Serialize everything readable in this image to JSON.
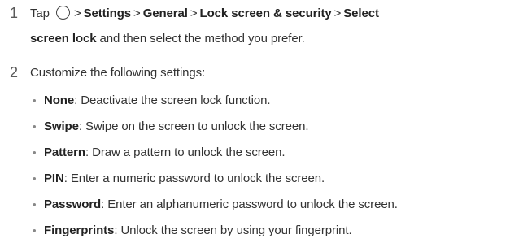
{
  "steps": [
    {
      "number": "1",
      "tap": "Tap",
      "icon": "home-circle-icon",
      "path": [
        "Settings",
        "General",
        "Lock screen & security",
        "Select"
      ],
      "path_separator": ">",
      "bold_continuation": "screen lock",
      "tail": " and then select the method you prefer."
    },
    {
      "number": "2",
      "text": "Customize the following settings:"
    }
  ],
  "settings": [
    {
      "name": "None",
      "desc": ": Deactivate the screen lock function."
    },
    {
      "name": "Swipe",
      "desc": ": Swipe on the screen to unlock the screen."
    },
    {
      "name": "Pattern",
      "desc": ": Draw a pattern to unlock the screen."
    },
    {
      "name": "PIN",
      "desc": ": Enter a numeric password to unlock the screen."
    },
    {
      "name": "Password",
      "desc": ": Enter an alphanumeric password to unlock the screen."
    },
    {
      "name": "Fingerprints",
      "desc": ": Unlock the screen by using your fingerprint."
    }
  ],
  "bullet_char": "•"
}
